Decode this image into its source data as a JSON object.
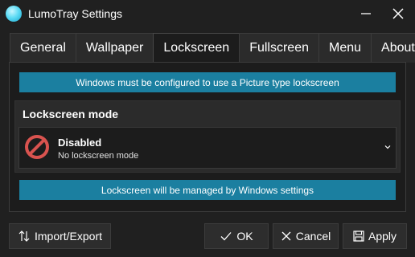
{
  "window": {
    "title": "LumoTray Settings",
    "app_icon": "app-orb-icon",
    "minimize_icon": "minimize-icon",
    "close_icon": "close-icon"
  },
  "tabs": [
    {
      "label": "General"
    },
    {
      "label": "Wallpaper"
    },
    {
      "label": "Lockscreen",
      "active": true
    },
    {
      "label": "Fullscreen"
    },
    {
      "label": "Menu"
    },
    {
      "label": "About"
    }
  ],
  "lockscreen": {
    "notice": "Windows must be configured to use a Picture type lockscreen",
    "mode_title": "Lockscreen mode",
    "mode": {
      "icon": "prohibited-icon",
      "title": "Disabled",
      "subtitle": "No lockscreen mode"
    },
    "status": "Lockscreen will be managed by Windows settings"
  },
  "buttons": {
    "import_export": "Import/Export",
    "ok": "OK",
    "cancel": "Cancel",
    "apply": "Apply"
  },
  "colors": {
    "background": "#202020",
    "accent_bar": "#1b7fa0",
    "prohibited_red": "#d9534f"
  }
}
